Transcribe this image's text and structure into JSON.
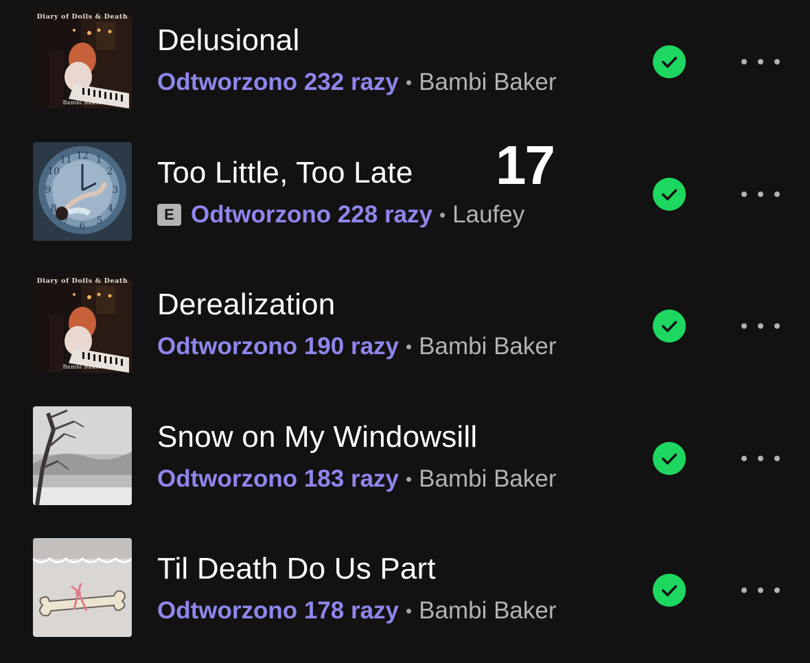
{
  "overlay_number": "17",
  "accent_color": "#8f86ec",
  "check_color": "#1ed760",
  "tracks": [
    {
      "title": "Delusional",
      "plays": "Odtworzono 232 razy",
      "separator": "•",
      "artist": "Bambi Baker",
      "explicit": "",
      "cover_caption": "Diary of Dolls & Death",
      "cover_sign": "Bambi Baker",
      "icon": "saved-check-icon"
    },
    {
      "title": "Too Little, Too Late",
      "plays": "Odtworzono 228 razy",
      "separator": "•",
      "artist": "Laufey",
      "explicit": "E",
      "cover_caption": "",
      "cover_sign": "",
      "icon": "saved-check-icon"
    },
    {
      "title": "Derealization",
      "plays": "Odtworzono 190 razy",
      "separator": "•",
      "artist": "Bambi Baker",
      "explicit": "",
      "cover_caption": "Diary of Dolls & Death",
      "cover_sign": "Bambi Baker",
      "icon": "saved-check-icon"
    },
    {
      "title": "Snow on My Windowsill",
      "plays": "Odtworzono 183 razy",
      "separator": "•",
      "artist": "Bambi Baker",
      "explicit": "",
      "cover_caption": "",
      "cover_sign": "",
      "icon": "saved-check-icon"
    },
    {
      "title": "Til Death Do Us Part",
      "plays": "Odtworzono 178 razy",
      "separator": "•",
      "artist": "Bambi Baker",
      "explicit": "",
      "cover_caption": "",
      "cover_sign": "",
      "icon": "saved-check-icon"
    }
  ]
}
